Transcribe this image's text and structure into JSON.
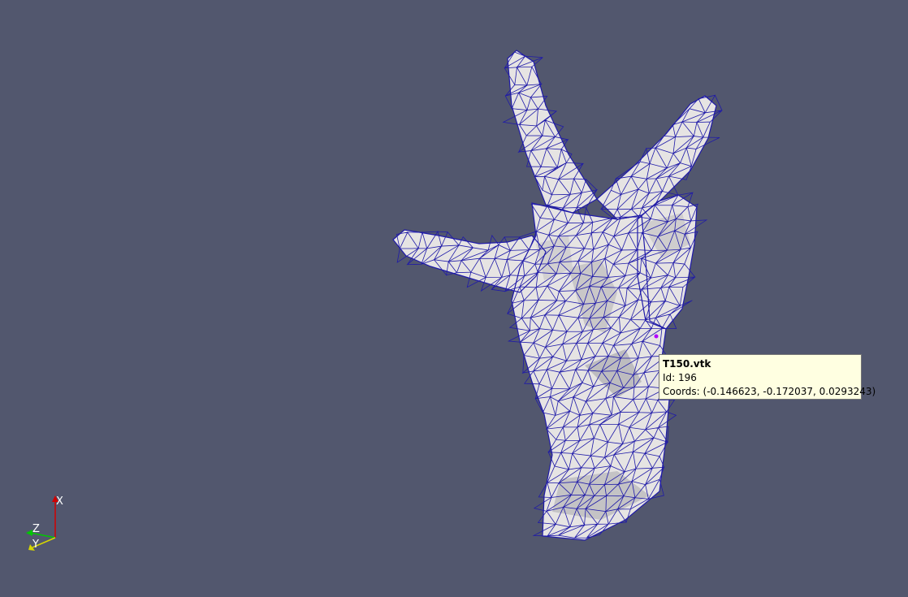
{
  "viewport": {
    "background": "#52576e",
    "mesh_fill": "#e6e4e3",
    "wire_color": "#1f1aa8"
  },
  "tooltip": {
    "title": "T150.vtk",
    "id_line": "Id: 196",
    "coords_line": "Coords: (-0.146623, -0.172037, 0.0293243)"
  },
  "axes": {
    "x_label": "X",
    "y_label": "Y",
    "z_label": "Z",
    "x_color": "#d10000",
    "y_color": "#d6d600",
    "z_color": "#00c800"
  },
  "icons": [
    "orientation-axes-icon",
    "picked-point-icon"
  ]
}
